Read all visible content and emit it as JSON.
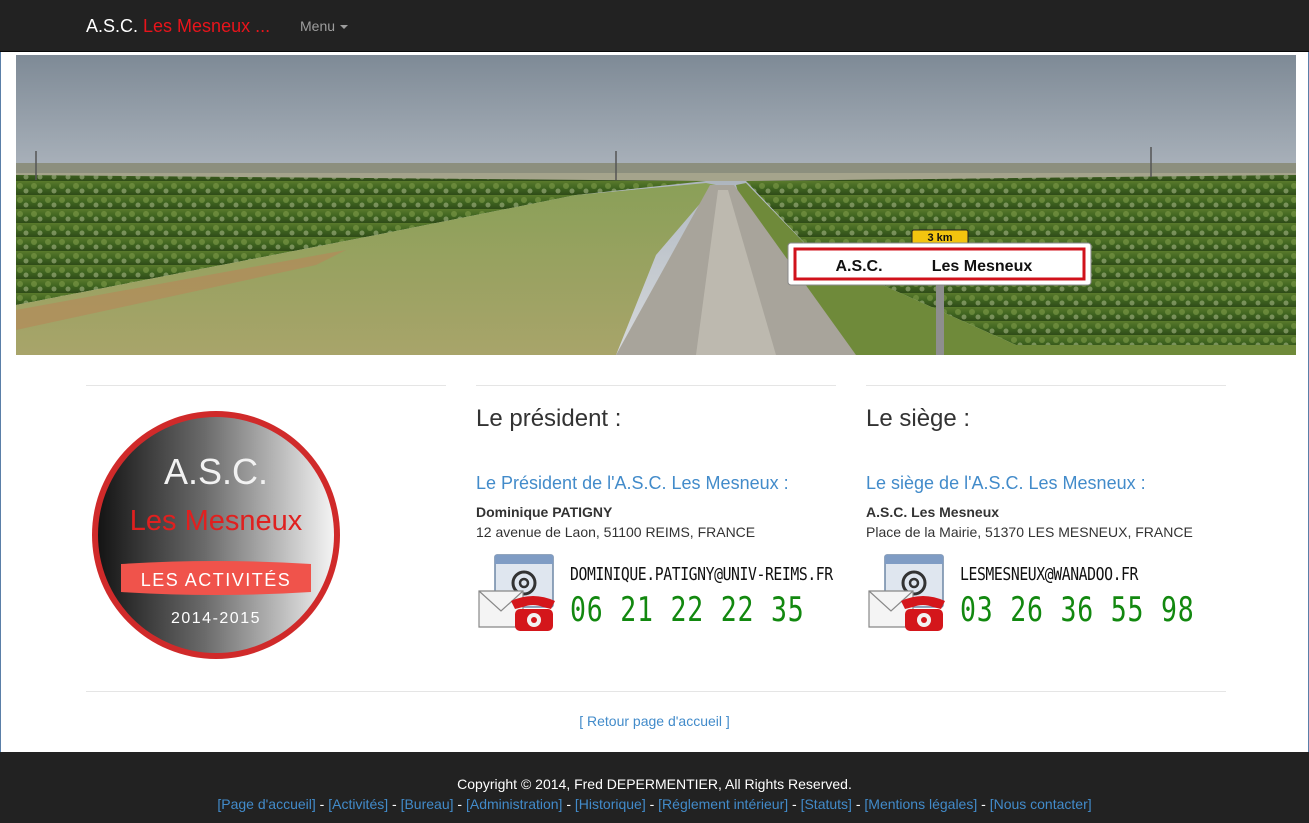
{
  "navbar": {
    "brand_prefix": "A.S.C.",
    "brand_highlight": "Les Mesneux ...",
    "menu_label": "Menu"
  },
  "banner": {
    "sign_distance": "3 km",
    "sign_text_left": "A.S.C.",
    "sign_text_right": "Les Mesneux"
  },
  "logo": {
    "line1": "A.S.C.",
    "line2": "Les Mesneux",
    "ribbon": "LES ACTIVITÉS",
    "years": "2014-2015"
  },
  "president": {
    "title": "Le président :",
    "subtitle": "Le Président de l'A.S.C. Les Mesneux :",
    "name": "Dominique PATIGNY",
    "address": "12 avenue de Laon, 51100 REIMS, FRANCE",
    "email": "DOMINIQUE.PATIGNY@UNIV-REIMS.FR",
    "phone": "06 21 22 22 35"
  },
  "siege": {
    "title": "Le siège :",
    "subtitle": "Le siège de l'A.S.C. Les Mesneux :",
    "name": "A.S.C. Les Mesneux",
    "address": "Place de la Mairie, 51370 LES MESNEUX, FRANCE",
    "email": "LESMESNEUX@WANADOO.FR",
    "phone": "03 26 36 55 98"
  },
  "retour_label": "[ Retour page d'accueil ]",
  "footer": {
    "copyright": "Copyright © 2014, Fred DEPERMENTIER, All Rights Reserved.",
    "links": [
      "[Page d'accueil]",
      "[Activités]",
      "[Bureau]",
      "[Administration]",
      "[Historique]",
      "[Réglement intérieur]",
      "[Statuts]",
      "[Mentions légales]",
      "[Nous contacter]"
    ],
    "separator": " - "
  },
  "colors": {
    "navbar_bg": "#222222",
    "brand_red": "#e8141b",
    "link_blue": "#428bca",
    "phone_green": "#12880f"
  }
}
